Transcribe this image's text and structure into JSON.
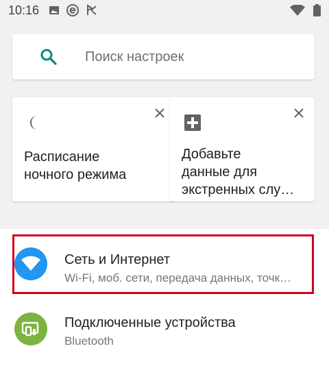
{
  "status_bar": {
    "time": "10:16",
    "icons": [
      "image-icon",
      "e-app-icon",
      "flag-icon",
      "wifi-icon",
      "battery-icon"
    ]
  },
  "search": {
    "placeholder": "Поиск настроек",
    "accent": "#00897b"
  },
  "suggestions": [
    {
      "icon": "moon-icon",
      "lines": [
        "Расписание",
        "ночного режима"
      ]
    },
    {
      "icon": "medical-plus-icon",
      "lines": [
        "Добавьте",
        "данные для",
        "экстренных слу…"
      ]
    }
  ],
  "settings": [
    {
      "icon": "wifi-icon",
      "title": "Сеть и Интернет",
      "subtitle": "Wi-Fi, моб. сети, передача данных, точк…",
      "icon_color": "#2196f3",
      "highlighted": true
    },
    {
      "icon": "devices-icon",
      "title": "Подключенные устройства",
      "subtitle": "Bluetooth",
      "icon_color": "#7cb342",
      "highlighted": false
    }
  ],
  "colors": {
    "highlight": "#d0021b",
    "background": "#f1f1f1"
  }
}
